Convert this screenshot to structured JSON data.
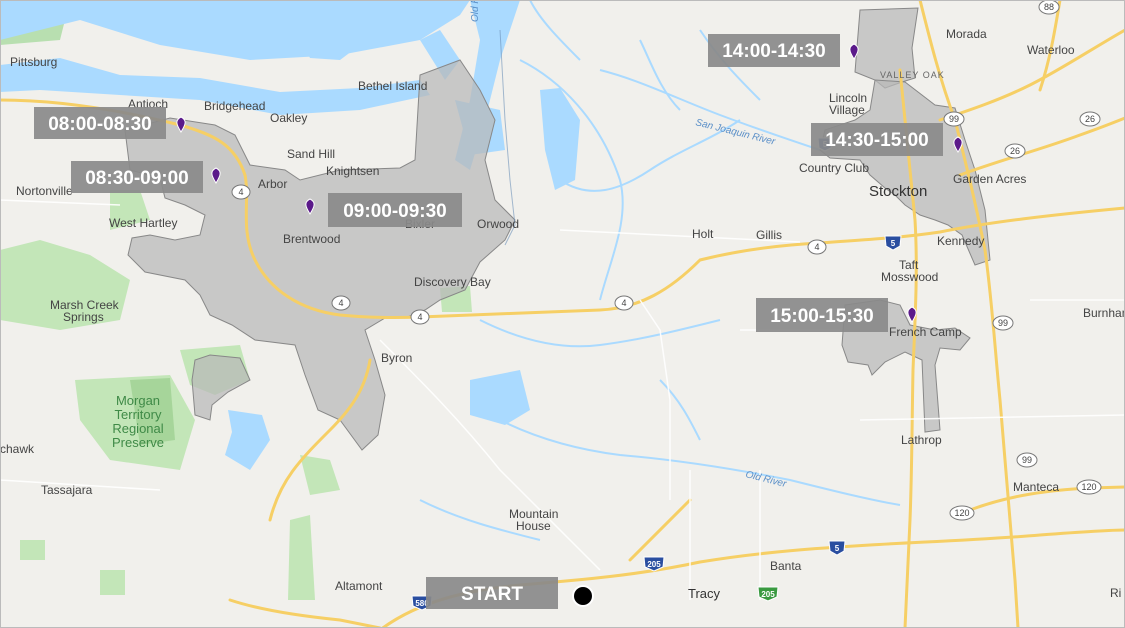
{
  "time_slots": [
    {
      "label": "08:00-08:30"
    },
    {
      "label": "08:30-09:00"
    },
    {
      "label": "09:00-09:30"
    },
    {
      "label": "14:00-14:30"
    },
    {
      "label": "14:30-15:00"
    },
    {
      "label": "15:00-15:30"
    }
  ],
  "start": {
    "label": "START"
  },
  "places": {
    "pittsburg": "Pittsburg",
    "antioch": "Antioch",
    "bridgehead": "Bridgehead",
    "bethel_island": "Bethel Island",
    "oakley": "Oakley",
    "sand_hill": "Sand Hill",
    "knightsen": "Knightsen",
    "arbor": "Arbor",
    "nortonville": "Nortonville",
    "west_hartley": "West Hartley",
    "brentwood": "Brentwood",
    "bixler": "Bixler",
    "orwood": "Orwood",
    "discovery_bay": "Discovery Bay",
    "marsh_creek": "Marsh Creek",
    "springs": "Springs",
    "byron": "Byron",
    "chawk": "chawk",
    "tassajara": "Tassajara",
    "altamont": "Altamont",
    "mountain": "Mountain",
    "house": "House",
    "tracy": "Tracy",
    "banta": "Banta",
    "holt": "Holt",
    "gillis": "Gillis",
    "lincoln": "Lincoln",
    "village": "Village",
    "country_club": "Country Club",
    "stockton": "Stockton",
    "garden_acres": "Garden Acres",
    "kennedy": "Kennedy",
    "taft": "Taft",
    "mosswood": "Mosswood",
    "french_camp": "French Camp",
    "lathrop": "Lathrop",
    "manteca": "Manteca",
    "burnham": "Burnhan",
    "morada": "Morada",
    "waterloo": "Waterloo",
    "valley_oak": "VALLEY OAK",
    "ri": "Ri",
    "old_ri": "Old Ri"
  },
  "park": {
    "line1": "Morgan",
    "line2": "Territory",
    "line3": "Regional",
    "line4": "Preserve"
  },
  "water_labels": {
    "san_joaquin": "San Joaquin River",
    "old_river": "Old River"
  },
  "shields": {
    "s4a": "4",
    "s4b": "4",
    "s4c": "4",
    "s4d": "4",
    "s4e": "4",
    "s26a": "26",
    "s26b": "26",
    "s99a": "99",
    "s99b": "99",
    "s99c": "99",
    "s88": "88",
    "s120a": "120",
    "s120b": "120",
    "i5a": "5",
    "i5b": "5",
    "i5c": "5",
    "i205a": "205",
    "i205b": "205",
    "i580": "580"
  },
  "colors": {
    "land": "#f1f0ec",
    "water": "#aadaff",
    "green": "#c3e6b8",
    "zone_fill": "#b9b9b9",
    "zone_border": "#888888",
    "highway": "#f6cf65",
    "pin": "#5b1a8a",
    "label_bg": "#8a8a8a"
  }
}
